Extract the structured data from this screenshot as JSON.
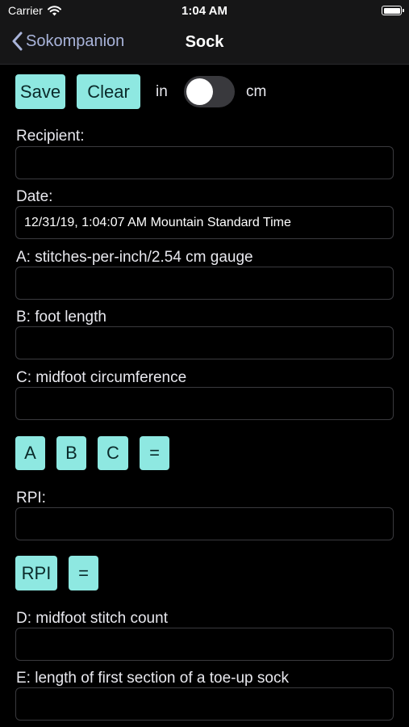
{
  "status": {
    "carrier": "Carrier",
    "time": "1:04 AM"
  },
  "nav": {
    "back_label": "Sokompanion",
    "title": "Sock"
  },
  "toolbar": {
    "save_label": "Save",
    "clear_label": "Clear",
    "unit_left": "in",
    "unit_right": "cm",
    "unit_toggle_on": false
  },
  "fields": {
    "recipient": {
      "label": "Recipient:",
      "value": ""
    },
    "date": {
      "label": "Date:",
      "value": "12/31/19, 1:04:07 AM Mountain Standard Time"
    },
    "a": {
      "label": "A: stitches-per-inch/2.54 cm gauge",
      "value": ""
    },
    "b": {
      "label": "B: foot length",
      "value": ""
    },
    "c": {
      "label": "C: midfoot circumference",
      "value": ""
    },
    "rpi": {
      "label": "RPI:",
      "value": ""
    },
    "d": {
      "label": "D: midfoot stitch count",
      "value": ""
    },
    "e": {
      "label": "E: length of first section of a toe-up sock",
      "value": ""
    }
  },
  "calc_buttons": {
    "a": "A",
    "b": "B",
    "c": "C",
    "equals": "="
  },
  "rpi_buttons": {
    "rpi": "RPI",
    "equals": "="
  },
  "colors": {
    "accent": "#8ee8e1",
    "link": "#a9b4da",
    "background": "#000000"
  }
}
